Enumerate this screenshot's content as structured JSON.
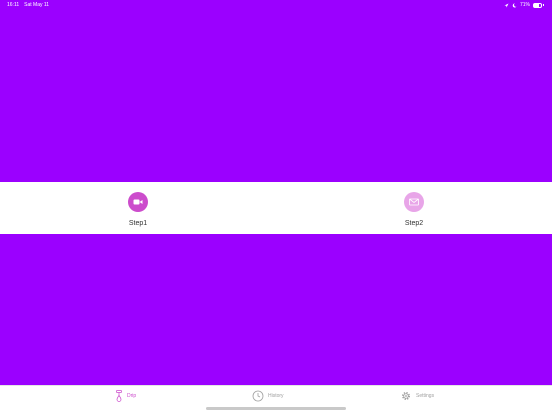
{
  "status_bar": {
    "time": "16:11",
    "date": "Sat May 11",
    "battery_percent": "71%",
    "battery_level": 0.71,
    "icons": [
      "location-icon",
      "moon-icon",
      "battery-icon"
    ]
  },
  "colors": {
    "background": "#9b00ff",
    "accent": "#cc4ccc",
    "accent_light": "#e8a5e8",
    "inactive": "#a0a0a0"
  },
  "steps": [
    {
      "label": "Step1",
      "icon": "video-camera-icon",
      "active": true
    },
    {
      "label": "Step2",
      "icon": "envelope-icon",
      "active": false
    }
  ],
  "tab_bar": {
    "tabs": [
      {
        "label": "Drip",
        "icon": "drip-icon",
        "selected": true
      },
      {
        "label": "History",
        "icon": "clock-icon",
        "selected": false
      },
      {
        "label": "Settings",
        "icon": "gear-icon",
        "selected": false
      }
    ]
  }
}
